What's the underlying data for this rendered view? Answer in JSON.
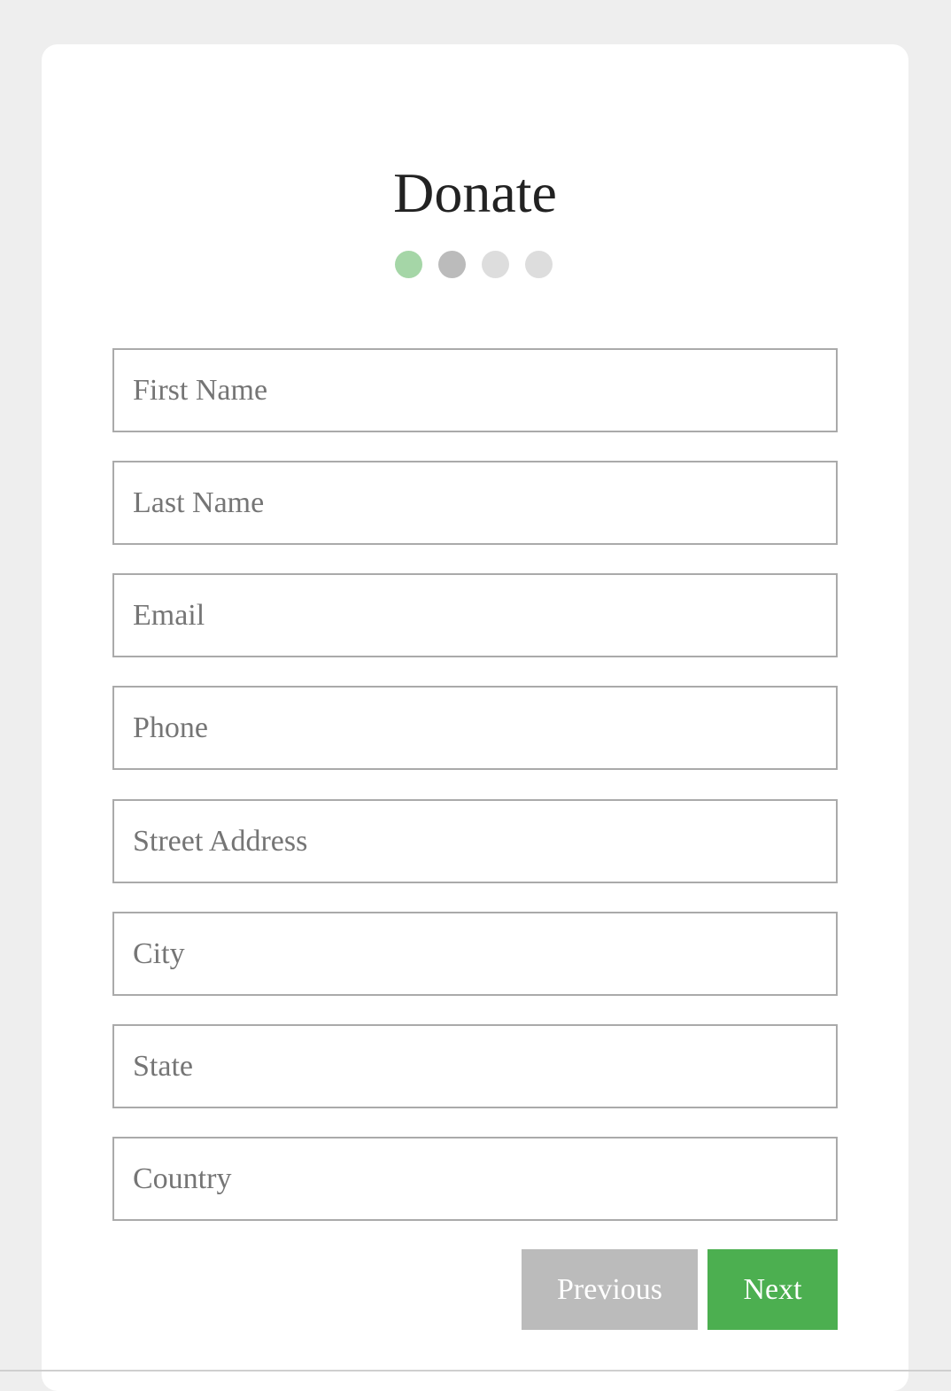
{
  "form": {
    "title": "Donate",
    "steps": [
      {
        "state": "completed",
        "color": "#a5d6a7"
      },
      {
        "state": "active",
        "color": "#bbbbbb"
      },
      {
        "state": "pending",
        "color": "#dddddd"
      },
      {
        "state": "pending",
        "color": "#dddddd"
      }
    ],
    "fields": {
      "first_name": {
        "placeholder": "First Name",
        "value": ""
      },
      "last_name": {
        "placeholder": "Last Name",
        "value": ""
      },
      "email": {
        "placeholder": "Email",
        "value": ""
      },
      "phone": {
        "placeholder": "Phone",
        "value": ""
      },
      "street_address": {
        "placeholder": "Street Address",
        "value": ""
      },
      "city": {
        "placeholder": "City",
        "value": ""
      },
      "state": {
        "placeholder": "State",
        "value": ""
      },
      "country": {
        "placeholder": "Country",
        "value": ""
      }
    },
    "buttons": {
      "previous_label": "Previous",
      "next_label": "Next"
    },
    "colors": {
      "accent": "#4caf50",
      "step_done": "#a5d6a7",
      "button_secondary": "#bbbbbb",
      "page_background": "#eeeeee"
    }
  }
}
